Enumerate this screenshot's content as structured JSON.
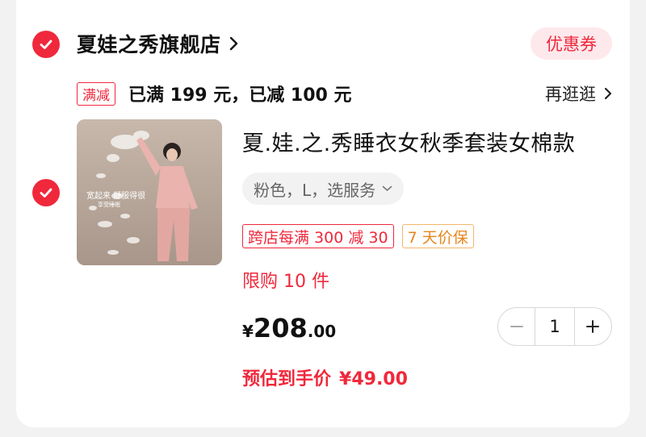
{
  "store": {
    "name": "夏娃之秀旗舰店",
    "coupon_label": "优惠券"
  },
  "promo": {
    "tag": "满减",
    "text": "已满 199 元，已减 100 元",
    "more_label": "再逛逛"
  },
  "product": {
    "title": "夏.娃.之.秀睡衣女秋季套装女棉款",
    "spec": "粉色，L，选服务",
    "tags": [
      "跨店每满 300 减 30",
      "7 天价保"
    ],
    "limit": "限购 10 件",
    "image_text_1": "宽起来 舒服得很",
    "image_text_2": "享受睡眠",
    "price": {
      "symbol": "¥",
      "integer": "208",
      "decimal": ".00"
    },
    "quantity": "1",
    "est_label": "预估到手价",
    "est_price": "¥49.00"
  },
  "colors": {
    "accent": "#f0283c",
    "coupon_bg": "#fde9ec",
    "orange_tag": "#e7861d",
    "product_bg": "#b9a89b"
  },
  "icons": {
    "store_check": "check-icon",
    "product_check": "check-icon",
    "store_arrow": "chevron-right-icon",
    "more_arrow": "chevron-right-icon",
    "spec_arrow": "chevron-down-icon",
    "minus": "minus-icon",
    "plus": "plus-icon"
  }
}
